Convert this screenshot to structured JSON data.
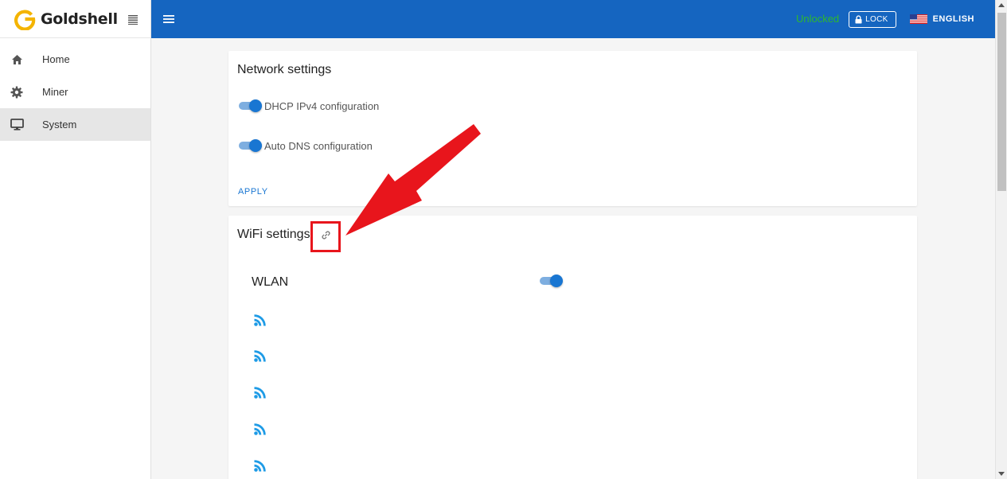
{
  "brand": {
    "name": "Goldshell"
  },
  "sidebar": {
    "items": [
      {
        "label": "Home",
        "icon": "home-icon"
      },
      {
        "label": "Miner",
        "icon": "gear-icon"
      },
      {
        "label": "System",
        "icon": "monitor-icon",
        "active": true
      }
    ]
  },
  "topbar": {
    "status": "Unlocked",
    "lock_label": "LOCK",
    "language": "ENGLISH"
  },
  "network": {
    "title": "Network settings",
    "dhcp_label": "DHCP IPv4 configuration",
    "dhcp_enabled": true,
    "dns_label": "Auto DNS configuration",
    "dns_enabled": true,
    "apply_label": "APPLY"
  },
  "wifi": {
    "title": "WiFi settings",
    "wlan_label": "WLAN",
    "wlan_enabled": true,
    "networks": [
      "",
      "",
      "",
      "",
      ""
    ]
  },
  "colors": {
    "topbar": "#1565c0",
    "accent": "#1976d2",
    "status_green": "#2eb82e",
    "brand_gold": "#f4b400",
    "annotation_red": "#e8151c"
  }
}
